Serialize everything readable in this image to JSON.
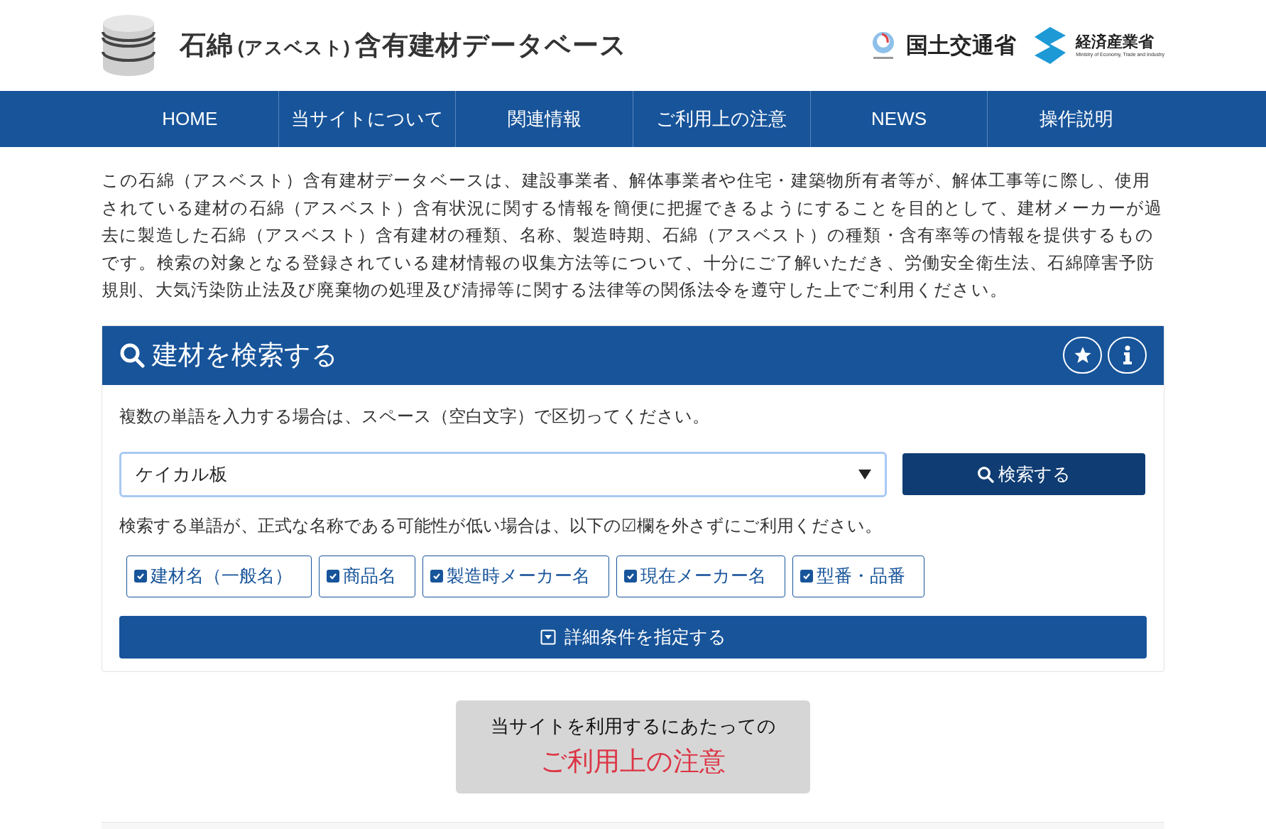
{
  "header": {
    "title_parts": [
      {
        "kind": "main",
        "text": "石綿"
      },
      {
        "kind": "note",
        "text": "(アスベスト)"
      },
      {
        "kind": "main",
        "text": "含有建材データベース"
      }
    ],
    "ministries": [
      {
        "kind": "mlit",
        "name": "国土交通省"
      },
      {
        "kind": "meti",
        "name": "経済産業省",
        "subtitle": "Ministry of Economy, Trade and Industry"
      }
    ]
  },
  "nav": [
    "HOME",
    "当サイトについて",
    "関連情報",
    "ご利用上の注意",
    "NEWS",
    "操作説明"
  ],
  "intro": "この石綿（アスベスト）含有建材データベースは、建設事業者、解体事業者や住宅・建築物所有者等が、解体工事等に際し、使用されている建材の石綿（アスベスト）含有状況に関する情報を簡便に把握できるようにすることを目的として、建材メーカーが過去に製造した石綿（アスベスト）含有建材の種類、名称、製造時期、石綿（アスベスト）の種類・含有率等の情報を提供するものです。検索の対象となる登録されている建材情報の収集方法等について、十分にご了解いただき、労働安全衛生法、石綿障害予防規則、大気汚染防止法及び廃棄物の処理及び清掃等に関する法律等の関係法令を遵守した上でご利用ください。",
  "search_panel": {
    "title": "建材を検索する",
    "hint": "複数の単語を入力する場合は、スペース（空白文字）で区切ってください。",
    "query": {
      "value": "ケイカル板"
    },
    "search_button": "検索する",
    "filter_hint": "検索する単語が、正式な名称である可能性が低い場合は、以下の☑欄を外さずにご利用ください。",
    "filters": [
      {
        "label": "建材名（一般名）",
        "checked": true
      },
      {
        "label": "商品名",
        "checked": true
      },
      {
        "label": "製造時メーカー名",
        "checked": true
      },
      {
        "label": "現在メーカー名",
        "checked": true
      },
      {
        "label": "型番・品番",
        "checked": true
      }
    ],
    "details_button": "詳細条件を指定する"
  },
  "notice_button": {
    "line1": "当サイトを利用するにあたっての",
    "line2": "ご利用上の注意"
  }
}
